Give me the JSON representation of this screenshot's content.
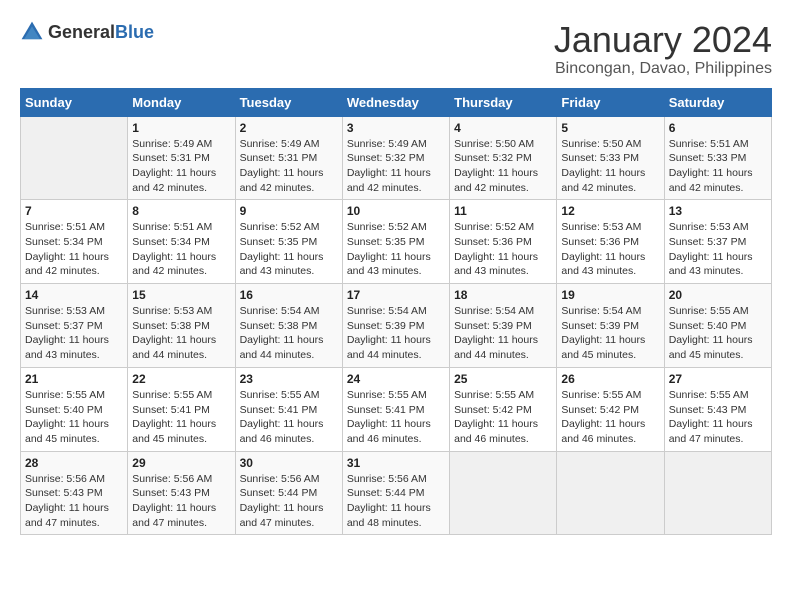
{
  "header": {
    "logo_general": "General",
    "logo_blue": "Blue",
    "title": "January 2024",
    "subtitle": "Bincongan, Davao, Philippines"
  },
  "calendar": {
    "days_of_week": [
      "Sunday",
      "Monday",
      "Tuesday",
      "Wednesday",
      "Thursday",
      "Friday",
      "Saturday"
    ],
    "weeks": [
      [
        {
          "day": "",
          "detail": ""
        },
        {
          "day": "1",
          "detail": "Sunrise: 5:49 AM\nSunset: 5:31 PM\nDaylight: 11 hours\nand 42 minutes."
        },
        {
          "day": "2",
          "detail": "Sunrise: 5:49 AM\nSunset: 5:31 PM\nDaylight: 11 hours\nand 42 minutes."
        },
        {
          "day": "3",
          "detail": "Sunrise: 5:49 AM\nSunset: 5:32 PM\nDaylight: 11 hours\nand 42 minutes."
        },
        {
          "day": "4",
          "detail": "Sunrise: 5:50 AM\nSunset: 5:32 PM\nDaylight: 11 hours\nand 42 minutes."
        },
        {
          "day": "5",
          "detail": "Sunrise: 5:50 AM\nSunset: 5:33 PM\nDaylight: 11 hours\nand 42 minutes."
        },
        {
          "day": "6",
          "detail": "Sunrise: 5:51 AM\nSunset: 5:33 PM\nDaylight: 11 hours\nand 42 minutes."
        }
      ],
      [
        {
          "day": "7",
          "detail": "Sunrise: 5:51 AM\nSunset: 5:34 PM\nDaylight: 11 hours\nand 42 minutes."
        },
        {
          "day": "8",
          "detail": "Sunrise: 5:51 AM\nSunset: 5:34 PM\nDaylight: 11 hours\nand 42 minutes."
        },
        {
          "day": "9",
          "detail": "Sunrise: 5:52 AM\nSunset: 5:35 PM\nDaylight: 11 hours\nand 43 minutes."
        },
        {
          "day": "10",
          "detail": "Sunrise: 5:52 AM\nSunset: 5:35 PM\nDaylight: 11 hours\nand 43 minutes."
        },
        {
          "day": "11",
          "detail": "Sunrise: 5:52 AM\nSunset: 5:36 PM\nDaylight: 11 hours\nand 43 minutes."
        },
        {
          "day": "12",
          "detail": "Sunrise: 5:53 AM\nSunset: 5:36 PM\nDaylight: 11 hours\nand 43 minutes."
        },
        {
          "day": "13",
          "detail": "Sunrise: 5:53 AM\nSunset: 5:37 PM\nDaylight: 11 hours\nand 43 minutes."
        }
      ],
      [
        {
          "day": "14",
          "detail": "Sunrise: 5:53 AM\nSunset: 5:37 PM\nDaylight: 11 hours\nand 43 minutes."
        },
        {
          "day": "15",
          "detail": "Sunrise: 5:53 AM\nSunset: 5:38 PM\nDaylight: 11 hours\nand 44 minutes."
        },
        {
          "day": "16",
          "detail": "Sunrise: 5:54 AM\nSunset: 5:38 PM\nDaylight: 11 hours\nand 44 minutes."
        },
        {
          "day": "17",
          "detail": "Sunrise: 5:54 AM\nSunset: 5:39 PM\nDaylight: 11 hours\nand 44 minutes."
        },
        {
          "day": "18",
          "detail": "Sunrise: 5:54 AM\nSunset: 5:39 PM\nDaylight: 11 hours\nand 44 minutes."
        },
        {
          "day": "19",
          "detail": "Sunrise: 5:54 AM\nSunset: 5:39 PM\nDaylight: 11 hours\nand 45 minutes."
        },
        {
          "day": "20",
          "detail": "Sunrise: 5:55 AM\nSunset: 5:40 PM\nDaylight: 11 hours\nand 45 minutes."
        }
      ],
      [
        {
          "day": "21",
          "detail": "Sunrise: 5:55 AM\nSunset: 5:40 PM\nDaylight: 11 hours\nand 45 minutes."
        },
        {
          "day": "22",
          "detail": "Sunrise: 5:55 AM\nSunset: 5:41 PM\nDaylight: 11 hours\nand 45 minutes."
        },
        {
          "day": "23",
          "detail": "Sunrise: 5:55 AM\nSunset: 5:41 PM\nDaylight: 11 hours\nand 46 minutes."
        },
        {
          "day": "24",
          "detail": "Sunrise: 5:55 AM\nSunset: 5:41 PM\nDaylight: 11 hours\nand 46 minutes."
        },
        {
          "day": "25",
          "detail": "Sunrise: 5:55 AM\nSunset: 5:42 PM\nDaylight: 11 hours\nand 46 minutes."
        },
        {
          "day": "26",
          "detail": "Sunrise: 5:55 AM\nSunset: 5:42 PM\nDaylight: 11 hours\nand 46 minutes."
        },
        {
          "day": "27",
          "detail": "Sunrise: 5:55 AM\nSunset: 5:43 PM\nDaylight: 11 hours\nand 47 minutes."
        }
      ],
      [
        {
          "day": "28",
          "detail": "Sunrise: 5:56 AM\nSunset: 5:43 PM\nDaylight: 11 hours\nand 47 minutes."
        },
        {
          "day": "29",
          "detail": "Sunrise: 5:56 AM\nSunset: 5:43 PM\nDaylight: 11 hours\nand 47 minutes."
        },
        {
          "day": "30",
          "detail": "Sunrise: 5:56 AM\nSunset: 5:44 PM\nDaylight: 11 hours\nand 47 minutes."
        },
        {
          "day": "31",
          "detail": "Sunrise: 5:56 AM\nSunset: 5:44 PM\nDaylight: 11 hours\nand 48 minutes."
        },
        {
          "day": "",
          "detail": ""
        },
        {
          "day": "",
          "detail": ""
        },
        {
          "day": "",
          "detail": ""
        }
      ]
    ]
  }
}
